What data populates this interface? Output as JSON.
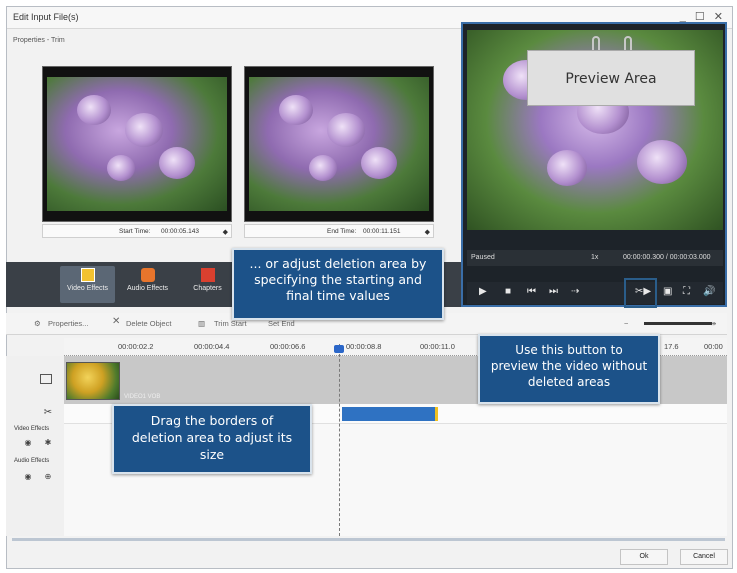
{
  "window": {
    "title": "Edit Input File(s)",
    "controls": "_ ☐ ✕"
  },
  "properties_label": "Properties - Trim",
  "start_time": {
    "label": "Start Time:",
    "value": "00:00:05.143"
  },
  "end_time": {
    "label": "End Time:",
    "value": "00:00:11.151"
  },
  "preview": {
    "note": "Preview Area",
    "status": "Paused",
    "speed": "1x",
    "time": "00:00:00.300 / 00:00:03.000"
  },
  "tabs": [
    {
      "label": "Video Effects"
    },
    {
      "label": "Audio Effects"
    },
    {
      "label": "Chapters"
    }
  ],
  "toolbar": {
    "properties": "Properties...",
    "delete": "Delete Object",
    "trim_start": "Trim Start",
    "set_end": "Set End"
  },
  "ruler": [
    "00:00:02.2",
    "00:00:04.4",
    "00:00:06.6",
    "00:00:08.8",
    "00:00:11.0",
    "17.6",
    "00:00"
  ],
  "track": {
    "video_label": "VIDEO1 VOB"
  },
  "sections": {
    "video_effects": "Video Effects",
    "audio_effects": "Audio Effects"
  },
  "buttons": {
    "ok": "Ok",
    "cancel": "Cancel"
  },
  "callouts": {
    "time_values": "... or adjust deletion area by specifying the starting and final time values",
    "preview_button": "Use this button to preview the video without deleted areas",
    "drag_borders": "Drag the borders of deletion area to adjust its size"
  },
  "colors": {
    "accent": "#1c5289",
    "cut_bar": "#2f72c2",
    "cut_edge": "#f0c020",
    "highlight_border": "#3a6ea8"
  }
}
